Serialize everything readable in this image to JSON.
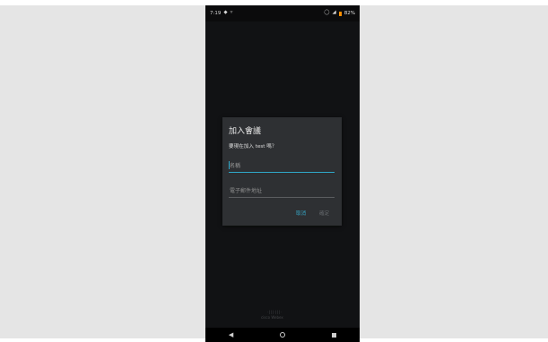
{
  "status_bar": {
    "time": "7:19",
    "left_icons": [
      "notification-icon",
      "wifi-icon"
    ],
    "right_icons": [
      "alarm-icon",
      "signal-icon"
    ],
    "battery": "82%"
  },
  "dialog": {
    "title": "加入會議",
    "message": "要現在加入 test 嗎？",
    "name_placeholder": "名稱",
    "email_placeholder": "電子郵件地址",
    "cancel_label": "取消",
    "ok_label": "確定"
  },
  "brand": {
    "logo_text": "·|||·|||·",
    "text": "cisco Webex"
  },
  "nav": {
    "back": "◀",
    "home": "",
    "recents": ""
  },
  "colors": {
    "accent": "#2fa8c9",
    "dialog_bg": "#2e3033",
    "screen_bg": "#111214"
  }
}
